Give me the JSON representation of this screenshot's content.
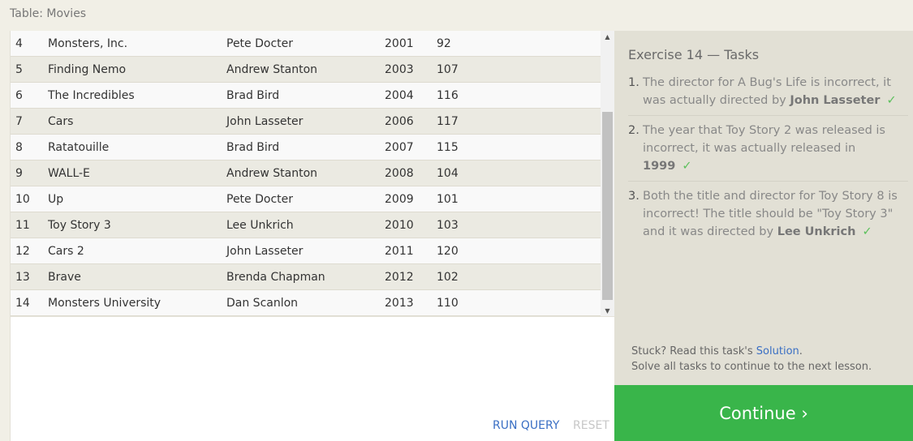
{
  "table_title": "Table: Movies",
  "rows": [
    [
      "4",
      "Monsters, Inc.",
      "Pete Docter",
      "2001",
      "92"
    ],
    [
      "5",
      "Finding Nemo",
      "Andrew Stanton",
      "2003",
      "107"
    ],
    [
      "6",
      "The Incredibles",
      "Brad Bird",
      "2004",
      "116"
    ],
    [
      "7",
      "Cars",
      "John Lasseter",
      "2006",
      "117"
    ],
    [
      "8",
      "Ratatouille",
      "Brad Bird",
      "2007",
      "115"
    ],
    [
      "9",
      "WALL-E",
      "Andrew Stanton",
      "2008",
      "104"
    ],
    [
      "10",
      "Up",
      "Pete Docter",
      "2009",
      "101"
    ],
    [
      "11",
      "Toy Story 3",
      "Lee Unkrich",
      "2010",
      "103"
    ],
    [
      "12",
      "Cars 2",
      "John Lasseter",
      "2011",
      "120"
    ],
    [
      "13",
      "Brave",
      "Brenda Chapman",
      "2012",
      "102"
    ],
    [
      "14",
      "Monsters University",
      "Dan Scanlon",
      "2013",
      "110"
    ]
  ],
  "scrollbar": {
    "up": "▲",
    "down": "▼"
  },
  "actions": {
    "run_query": "RUN QUERY",
    "reset": "RESET"
  },
  "exercise": {
    "title": "Exercise 14 — Tasks",
    "tasks": [
      {
        "num": "1.",
        "pre": "The director for A Bug's Life is incorrect, it was actually directed by ",
        "bold": "John Lasseter",
        "post": "",
        "check": "✓"
      },
      {
        "num": "2.",
        "pre": "The year that Toy Story 2 was released is incorrect, it was actually released in ",
        "bold": "1999",
        "post": "",
        "check": "✓"
      },
      {
        "num": "3.",
        "pre": "Both the title and director for Toy Story 8 is incorrect! The title should be \"Toy Story 3\" and it was directed by ",
        "bold": "Lee Unkrich",
        "post": "",
        "check": "✓"
      }
    ],
    "stuck_pre": "Stuck? Read this task's ",
    "solution_link": "Solution",
    "stuck_post": ".",
    "solve_all": "Solve all tasks to continue to the next lesson."
  },
  "continue_label": "Continue ›",
  "colors": {
    "accent_green": "#39b54a",
    "link_blue": "#3a6fc4"
  }
}
